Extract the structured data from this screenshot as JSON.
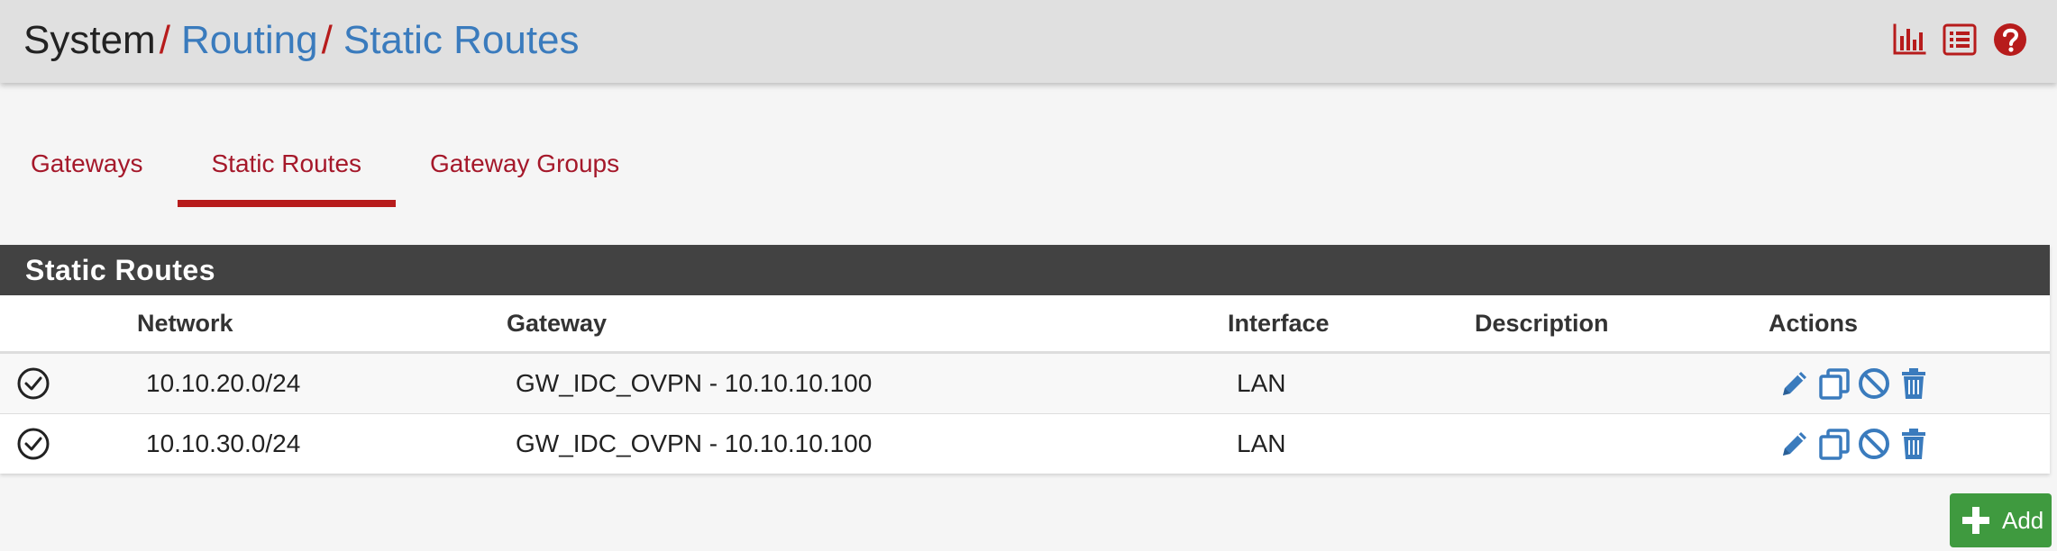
{
  "breadcrumb": {
    "root": "System",
    "separator": "/",
    "section": "Routing",
    "page": "Static Routes"
  },
  "header_icons": [
    "status-chart-icon",
    "logs-list-icon",
    "help-icon"
  ],
  "tabs": [
    {
      "label": "Gateways",
      "active": false
    },
    {
      "label": "Static Routes",
      "active": true
    },
    {
      "label": "Gateway Groups",
      "active": false
    }
  ],
  "panel": {
    "title": "Static Routes",
    "columns": {
      "network": "Network",
      "gateway": "Gateway",
      "interface": "Interface",
      "description": "Description",
      "actions": "Actions"
    },
    "rows": [
      {
        "enabled": true,
        "network": "10.10.20.0/24",
        "gateway": "GW_IDC_OVPN - 10.10.10.100",
        "interface": "LAN",
        "description": ""
      },
      {
        "enabled": true,
        "network": "10.10.30.0/24",
        "gateway": "GW_IDC_OVPN - 10.10.10.100",
        "interface": "LAN",
        "description": ""
      }
    ],
    "action_icons": [
      "edit-icon",
      "copy-icon",
      "disable-icon",
      "delete-icon"
    ]
  },
  "add_button": {
    "label": "Add"
  },
  "colors": {
    "header_bg": "#e0e0e0",
    "link_blue": "#3a7bbd",
    "brand_red": "#b71c1c",
    "tab_text": "#a5182a",
    "panel_heading_bg": "#424242",
    "action_blue": "#3a7bbd",
    "add_green": "#3f9a3f"
  }
}
